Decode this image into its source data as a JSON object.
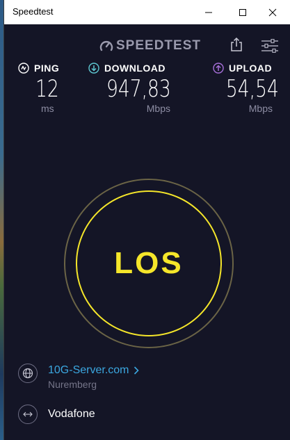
{
  "window": {
    "title": "Speedtest"
  },
  "header": {
    "logo_text": "SPEEDTEST",
    "icons": [
      "share-icon",
      "settings-sliders-icon"
    ]
  },
  "metrics": {
    "ping": {
      "label": "PING",
      "value": "12",
      "unit": "ms",
      "icon": "ping-icon"
    },
    "download": {
      "label": "DOWNLOAD",
      "value": "947,83",
      "unit": "Mbps",
      "icon": "download-arrow-icon",
      "color": "#5ec8d2"
    },
    "upload": {
      "label": "UPLOAD",
      "value": "54,54",
      "unit": "Mbps",
      "icon": "upload-arrow-icon",
      "color": "#a66fd9"
    }
  },
  "go_button": {
    "label": "LOS",
    "color": "#f5e62a"
  },
  "server": {
    "name": "10G-Server.com",
    "location": "Nuremberg",
    "icon": "globe-icon",
    "color": "#3ba7e0"
  },
  "isp": {
    "name": "Vodafone",
    "icon": "connection-arrows-icon"
  },
  "colors": {
    "background": "#141526",
    "muted_text": "#8d8da3"
  }
}
